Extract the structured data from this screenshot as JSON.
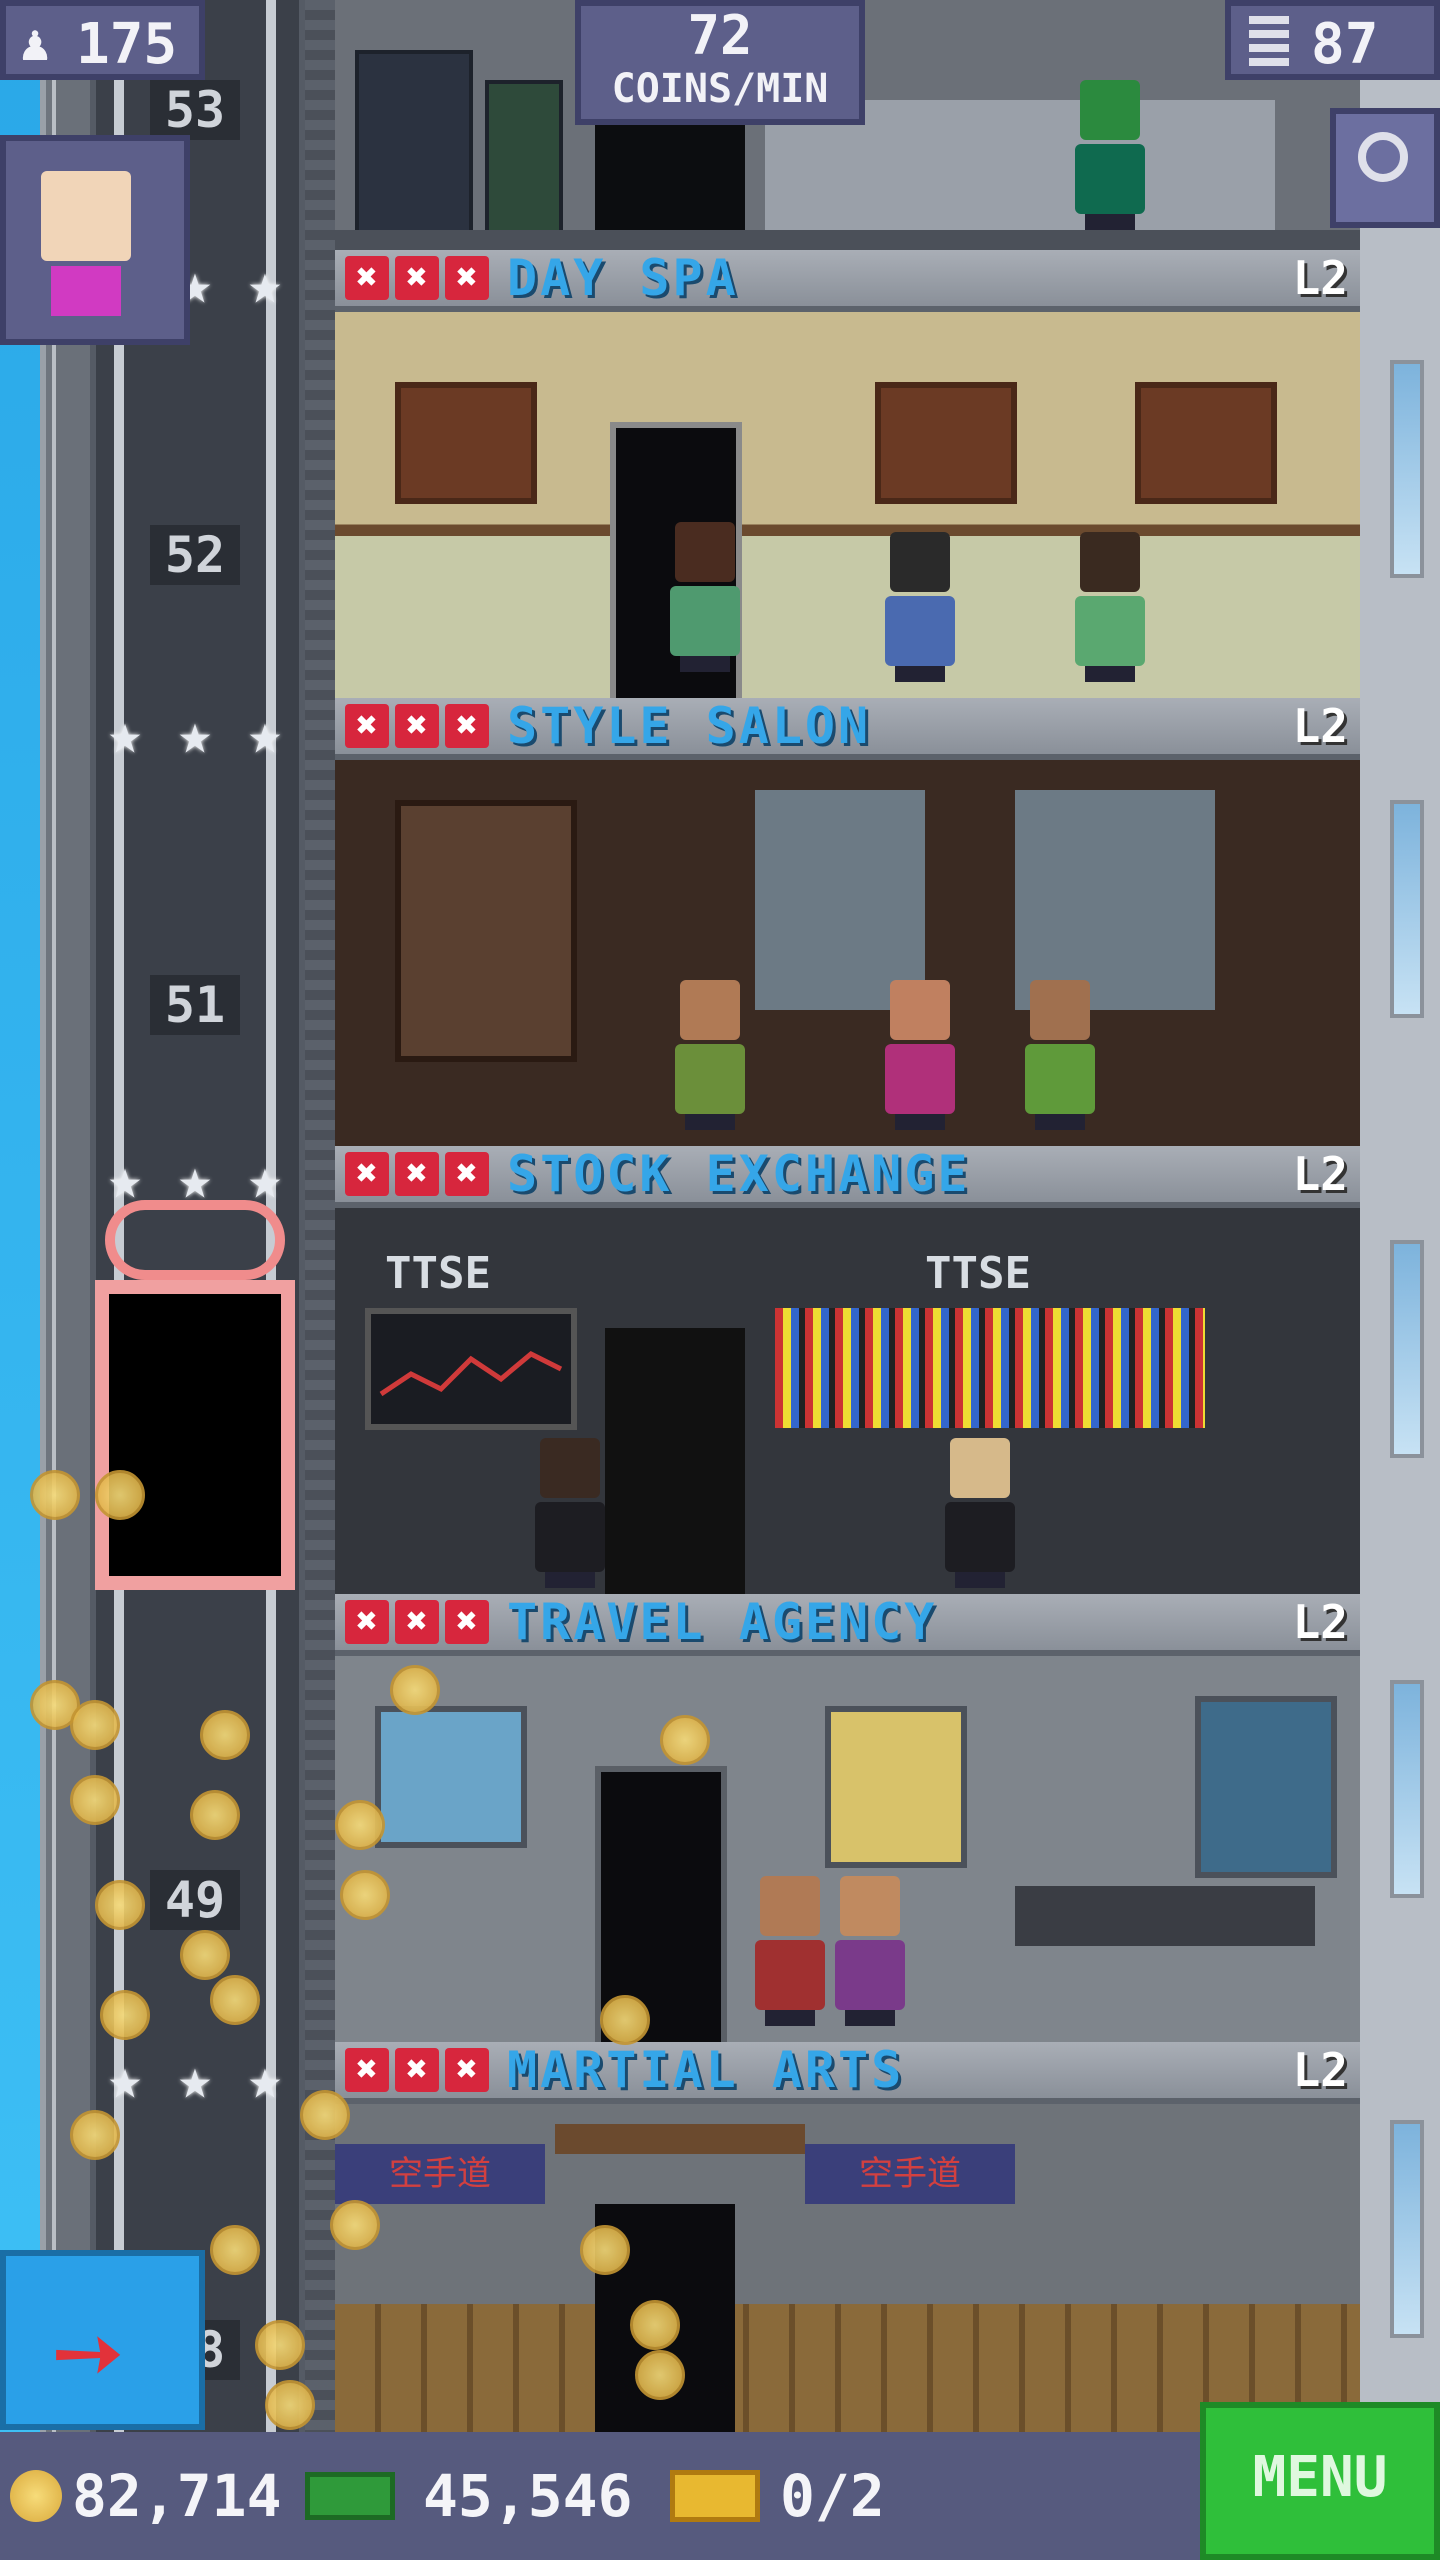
{
  "hud": {
    "population": "175",
    "coins_per_min_value": "72",
    "coins_per_min_unit": "COINS/MIN",
    "floors_count": "87"
  },
  "shaft_numbers": [
    "53",
    "52",
    "51",
    "49",
    "48"
  ],
  "floors": [
    {
      "name": "DAY SPA",
      "level": "L2",
      "marks": [
        "✖",
        "✖",
        "✖"
      ]
    },
    {
      "name": "STYLE SALON",
      "level": "L2",
      "marks": [
        "✖",
        "✖",
        "✖"
      ]
    },
    {
      "name": "STOCK EXCHANGE",
      "level": "L2",
      "marks": [
        "✖",
        "✖",
        "✖"
      ],
      "signs": [
        "TTSE",
        "TTSE"
      ]
    },
    {
      "name": "TRAVEL AGENCY",
      "level": "L2",
      "marks": [
        "✖",
        "✖",
        "✖"
      ]
    },
    {
      "name": "MARTIAL ARTS",
      "level": "L2",
      "marks": [
        "✖",
        "✖",
        "✖"
      ],
      "signs": [
        "空手道",
        "空手道"
      ]
    }
  ],
  "bottom": {
    "coins": "82,714",
    "bux": "45,546",
    "tickets": "0/2",
    "menu_label": "MENU"
  },
  "colors": {
    "floor_title": "#35a6e8",
    "mark_red": "#d7263d",
    "hud_bg": "#5d5f8a",
    "menu_green": "#2fbf3a",
    "sky": "#3ec0f5"
  },
  "icons": [
    "person-icon",
    "building-icon",
    "search-icon",
    "coin-icon",
    "bux-icon",
    "ticket-icon",
    "arrow-up-icon",
    "star-icon",
    "close-icon"
  ]
}
